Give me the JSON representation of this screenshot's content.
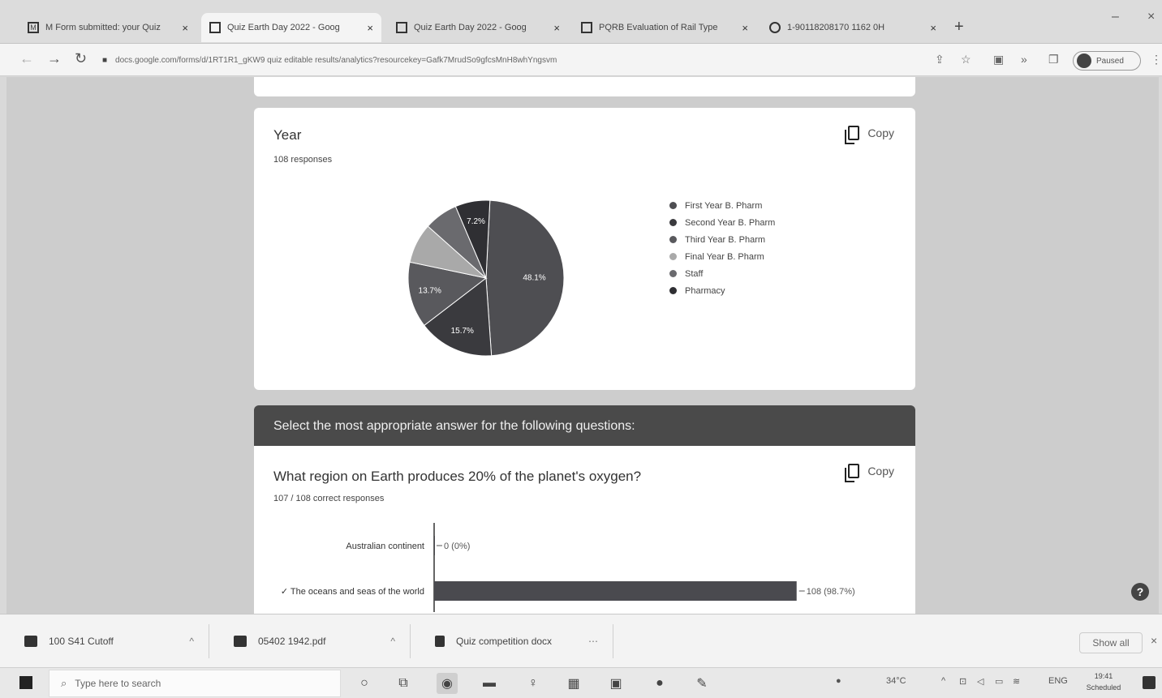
{
  "browser": {
    "tabs": [
      {
        "label": "M Form submitted: your Quiz",
        "active": false
      },
      {
        "label": "Quiz Earth Day 2022 - Goog",
        "active": true
      },
      {
        "label": "Quiz Earth Day 2022 - Goog",
        "active": false
      },
      {
        "label": "PQRB Evaluation of Rail Type",
        "active": false
      },
      {
        "label": "1-90118208170 1162 0H",
        "active": false
      }
    ],
    "new_tab": "+",
    "address": "docs.google.com/forms/d/1RT1R1_gKW9 quiz editable results/analytics?resourcekey=Gafk7MrudSo9gfcsMnH8whYngsvm",
    "profile_label": "Paused"
  },
  "year_card": {
    "title": "Year",
    "subtitle": "108 responses",
    "copy_label": "Copy"
  },
  "section": {
    "header": "Select the most appropriate answer for the following questions:"
  },
  "q2_card": {
    "title": "What region on Earth produces 20% of the planet's oxygen?",
    "subtitle": "107 / 108 correct responses",
    "copy_label": "Copy"
  },
  "chart_data": [
    {
      "type": "pie",
      "title": "Year",
      "legend_position": "right",
      "slices": [
        {
          "label": "First Year B. Pharm",
          "value": 48.1,
          "color": "#4e4e52",
          "display": "48.1%"
        },
        {
          "label": "Second Year B. Pharm",
          "value": 15.7,
          "color": "#3a3a3e",
          "display": "15.7%"
        },
        {
          "label": "Third Year B. Pharm",
          "value": 13.7,
          "color": "#59595d",
          "display": "13.7%"
        },
        {
          "label": "Final Year B. Pharm",
          "value": 8.3,
          "color": "#a9a9a9",
          "display": ""
        },
        {
          "label": "Staff",
          "value": 7.0,
          "color": "#6a6a6e",
          "display": ""
        },
        {
          "label": "Pharmacy",
          "value": 7.2,
          "color": "#2f2f33",
          "display": "7.2%"
        }
      ]
    },
    {
      "type": "bar",
      "orientation": "horizontal",
      "categories": [
        "Australian continent",
        "✓ The oceans and seas of the world"
      ],
      "values": [
        0,
        108
      ],
      "labels": [
        "0 (0%)",
        "108 (98.7%)"
      ],
      "xlim": [
        0,
        110
      ]
    }
  ],
  "help_icon": "?",
  "downloads": {
    "items": [
      {
        "name": "100 S41 Cutoff"
      },
      {
        "name": "05402 1942.pdf"
      },
      {
        "name": "Quiz competition docx"
      }
    ],
    "show_all": "Show all"
  },
  "taskbar": {
    "search_placeholder": "Type here to search",
    "tray_temp": "34°C",
    "tray_lang": "ENG",
    "clock_time": "19:41",
    "clock_date": "Scheduled"
  }
}
